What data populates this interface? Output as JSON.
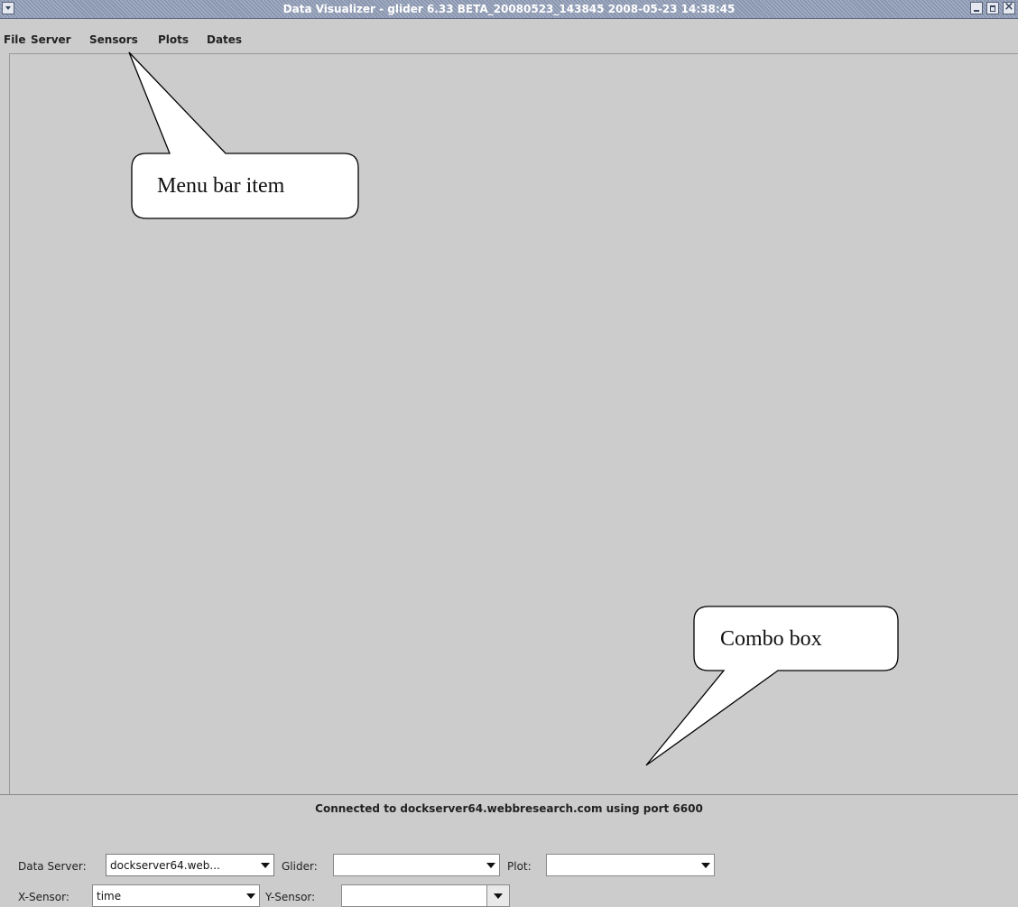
{
  "window": {
    "title": "Data Visualizer - glider 6.33  BETA_20080523_143845 2008-05-23 14:38:45"
  },
  "menubar": {
    "items": [
      "File",
      "Server",
      "Sensors",
      "Plots",
      "Dates"
    ]
  },
  "annotations": {
    "menu_callout": "Menu bar item",
    "combo_callout": "Combo box"
  },
  "status": {
    "text": "Connected to dockserver64.webbresearch.com using port 6600"
  },
  "controls": {
    "data_server_label": "Data Server:",
    "data_server_value": "dockserver64.web...",
    "glider_label": "Glider:",
    "glider_value": "",
    "plot_label": "Plot:",
    "plot_value": "",
    "x_sensor_label": "X-Sensor:",
    "x_sensor_value": "time",
    "y_sensor_label": "Y-Sensor:",
    "y_sensor_value": ""
  }
}
